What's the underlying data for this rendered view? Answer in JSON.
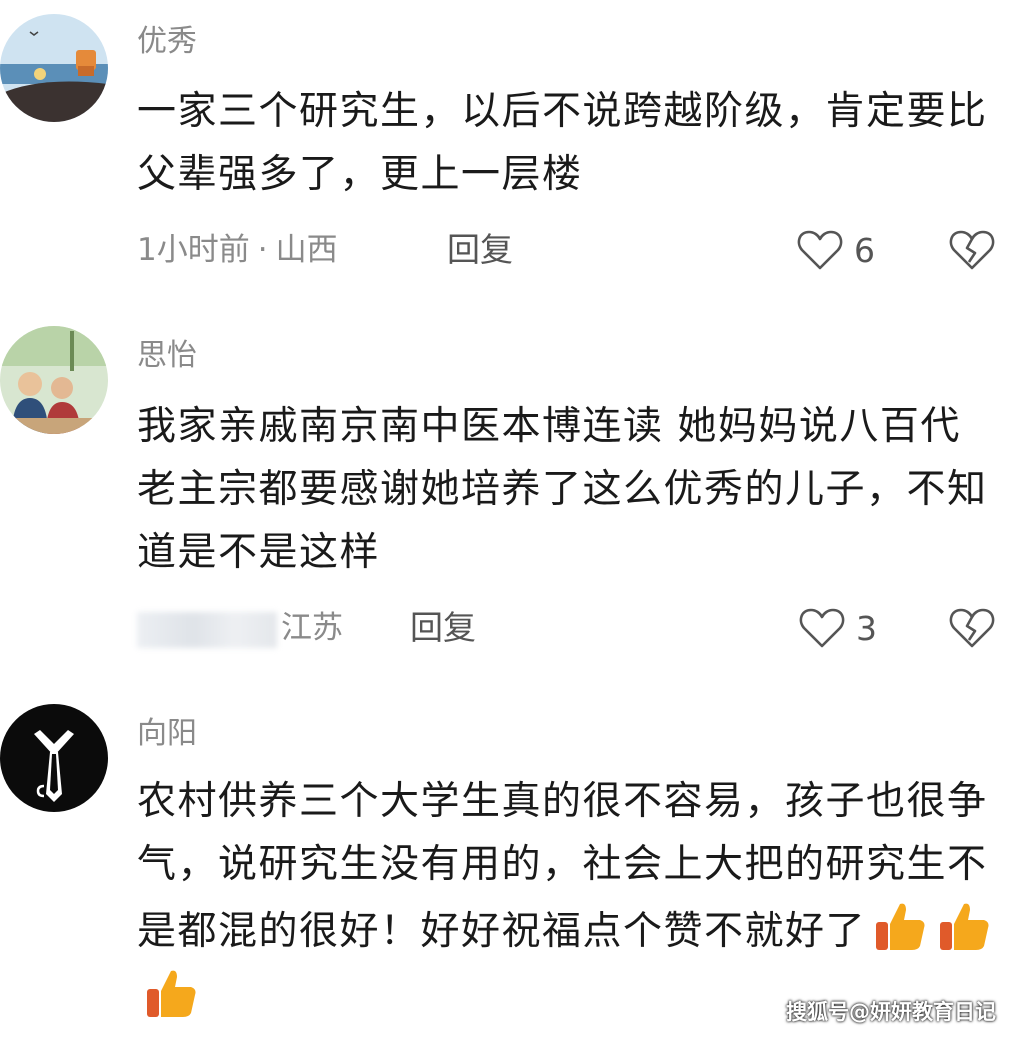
{
  "comments": [
    {
      "username": "优秀",
      "text": "一家三个研究生，以后不说跨越阶级，肯定要比父辈强多了，更上一层楼",
      "time": "1小时前",
      "separator": "·",
      "location": "山西",
      "reply_label": "回复",
      "likes": "6"
    },
    {
      "username": "思怡",
      "text": "我家亲戚南京南中医本博连读 她妈妈说八百代老主宗都要感谢她培养了这么优秀的儿子，不知道是不是这样",
      "location": "江苏",
      "reply_label": "回复",
      "likes": "3"
    },
    {
      "username": "向阳",
      "text": "农村供养三个大学生真的很不容易，孩子也很争气，说研究生没有用的，社会上大把的研究生不是都混的很好！好好祝福点个赞不就好了"
    }
  ],
  "icons": {
    "like": "heart-outline-icon",
    "dislike": "broken-heart-icon",
    "emoji": "thumbs-up-emoji"
  },
  "watermark": "搜狐号@妍妍教育日记",
  "colors": {
    "text": "#1a1a1a",
    "secondary": "#8a8a8a",
    "emoji": "#f5a81c"
  }
}
